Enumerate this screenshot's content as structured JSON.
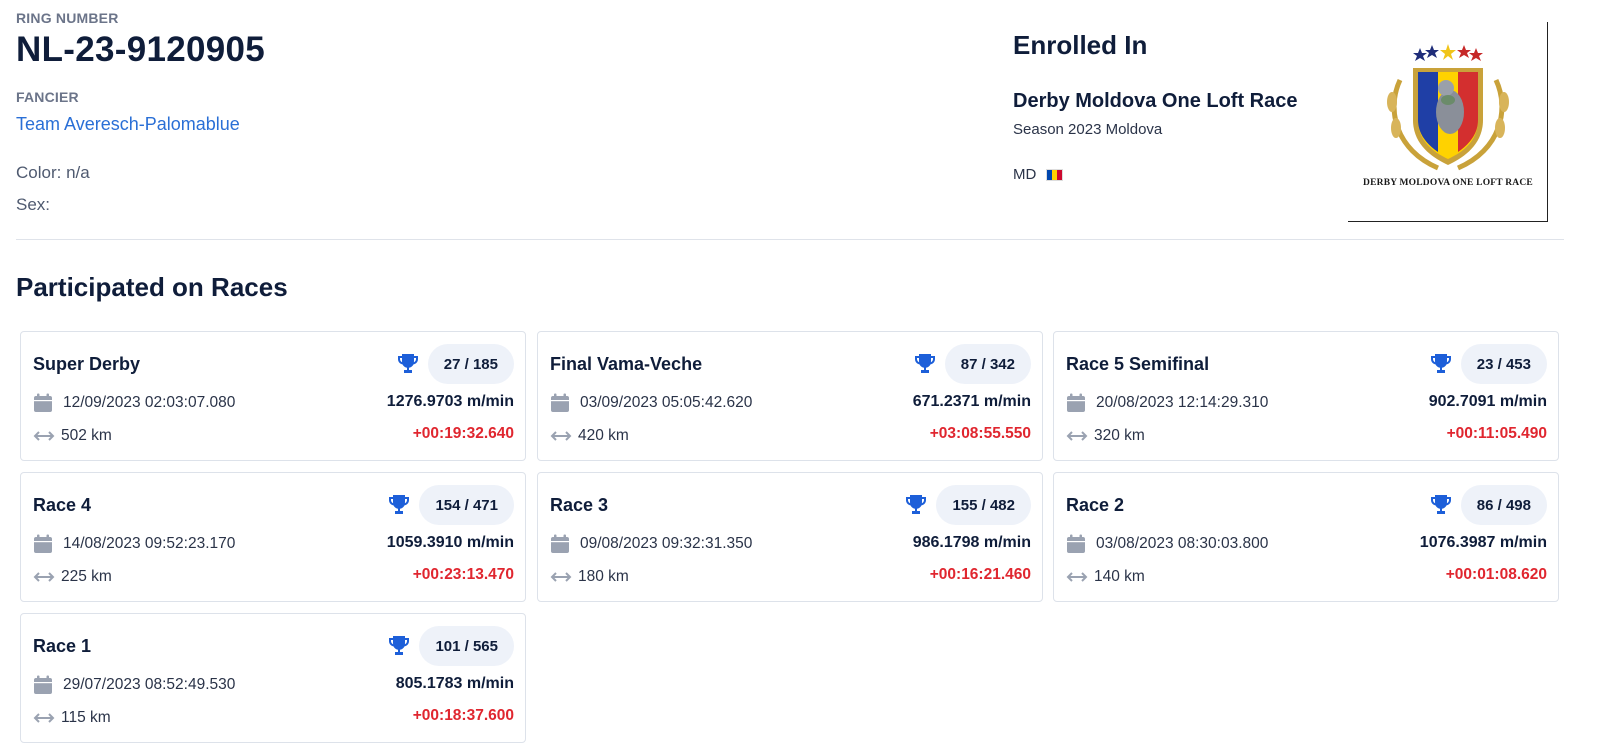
{
  "pigeon": {
    "ring_label": "RING NUMBER",
    "ring_number": "NL-23-9120905",
    "fancier_label": "FANCIER",
    "fancier_name": "Team Averesch-Palomablue",
    "color_line": "Color: n/a",
    "sex_line": "Sex:"
  },
  "enrollment": {
    "title": "Enrolled In",
    "race_name": "Derby Moldova One Loft Race",
    "season": "Season 2023 Moldova",
    "country": "MD",
    "logo_text": "DERBY MOLDOVA ONE LOFT RACE"
  },
  "races_title": "Participated on Races",
  "races": [
    {
      "name": "Super Derby",
      "rank": "27 / 185",
      "date": "12/09/2023 02:03:07.080",
      "speed": "1276.9703 m/min",
      "distance": "502 km",
      "delta": "+00:19:32.640"
    },
    {
      "name": "Final Vama-Veche",
      "rank": "87 / 342",
      "date": "03/09/2023 05:05:42.620",
      "speed": "671.2371 m/min",
      "distance": "420 km",
      "delta": "+03:08:55.550"
    },
    {
      "name": "Race 5 Semifinal",
      "rank": "23 / 453",
      "date": "20/08/2023 12:14:29.310",
      "speed": "902.7091 m/min",
      "distance": "320 km",
      "delta": "+00:11:05.490"
    },
    {
      "name": "Race 4",
      "rank": "154 / 471",
      "date": "14/08/2023 09:52:23.170",
      "speed": "1059.3910 m/min",
      "distance": "225 km",
      "delta": "+00:23:13.470"
    },
    {
      "name": "Race 3",
      "rank": "155 / 482",
      "date": "09/08/2023 09:32:31.350",
      "speed": "986.1798 m/min",
      "distance": "180 km",
      "delta": "+00:16:21.460"
    },
    {
      "name": "Race 2",
      "rank": "86 / 498",
      "date": "03/08/2023 08:30:03.800",
      "speed": "1076.3987 m/min",
      "distance": "140 km",
      "delta": "+00:01:08.620"
    },
    {
      "name": "Race 1",
      "rank": "101 / 565",
      "date": "29/07/2023 08:52:49.530",
      "speed": "805.1783 m/min",
      "distance": "115 km",
      "delta": "+00:18:37.600"
    }
  ],
  "colors": {
    "accent_link": "#2a6fd6",
    "trophy": "#1d5fd9",
    "delta": "#e0262f"
  },
  "icons": {
    "trophy": "trophy-icon",
    "calendar": "calendar-icon",
    "distance": "distance-arrows-icon"
  }
}
